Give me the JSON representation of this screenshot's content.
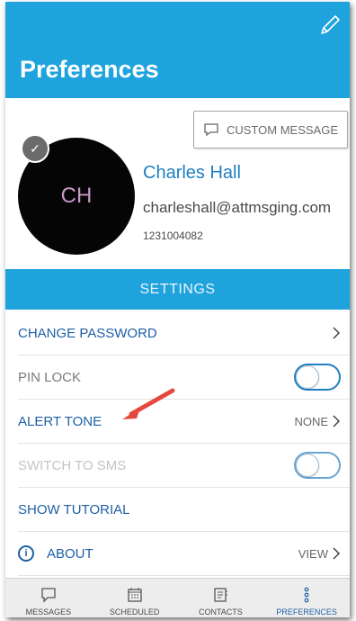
{
  "header": {
    "title": "Preferences",
    "edit_icon": "pencil-icon"
  },
  "profile": {
    "custom_message_label": "CUSTOM MESSAGE",
    "initials": "CH",
    "name": "Charles Hall",
    "email": "charleshall@attmsging.com",
    "phone": "1231004082"
  },
  "settings": {
    "title": "SETTINGS",
    "items": [
      {
        "label": "CHANGE PASSWORD"
      },
      {
        "label": "PIN LOCK",
        "toggle": false
      },
      {
        "label": "ALERT TONE",
        "value": "NONE"
      },
      {
        "label": "SWITCH TO SMS",
        "toggle": false
      },
      {
        "label": "SHOW TUTORIAL"
      },
      {
        "label": "ABOUT",
        "value": "VIEW"
      }
    ]
  },
  "tabs": [
    {
      "label": "MESSAGES",
      "icon": "message-icon"
    },
    {
      "label": "SCHEDULED",
      "icon": "calendar-icon"
    },
    {
      "label": "CONTACTS",
      "icon": "contacts-icon"
    },
    {
      "label": "PREFERENCES",
      "icon": "more-vertical-icon",
      "active": true
    }
  ],
  "colors": {
    "accent": "#1fa3dd",
    "link": "#1f5fa6",
    "arrow": "#e4483e"
  }
}
